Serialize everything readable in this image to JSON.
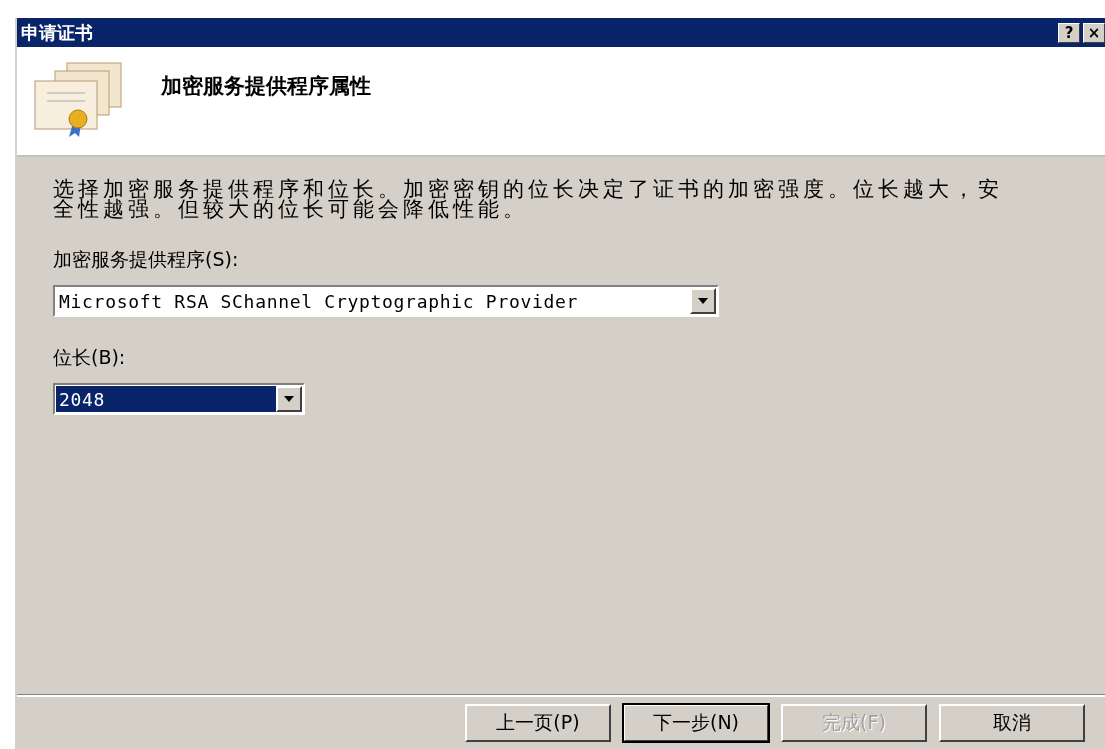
{
  "window": {
    "title": "申请证书",
    "title_buttons": [
      "?",
      "×"
    ]
  },
  "header": {
    "title": "加密服务提供程序属性"
  },
  "description": "选择加密服务提供程序和位长。加密密钥的位长决定了证书的加密强度。位长越大，安全性越强。但较大的位长可能会降低性能。",
  "fields": [
    {
      "label": "加密服务提供程序(S):",
      "value": "Microsoft RSA SChannel Cryptographic Provider",
      "focused": false,
      "wide": true
    },
    {
      "label": "位长(B):",
      "value": "2048",
      "focused": true,
      "wide": false
    }
  ],
  "buttons": [
    {
      "label": "上一页(P)",
      "disabled": false,
      "default": false
    },
    {
      "label": "下一步(N)",
      "disabled": false,
      "default": true
    },
    {
      "label": "完成(F)",
      "disabled": true,
      "default": false
    },
    {
      "label": "取消",
      "disabled": false,
      "default": false
    }
  ]
}
